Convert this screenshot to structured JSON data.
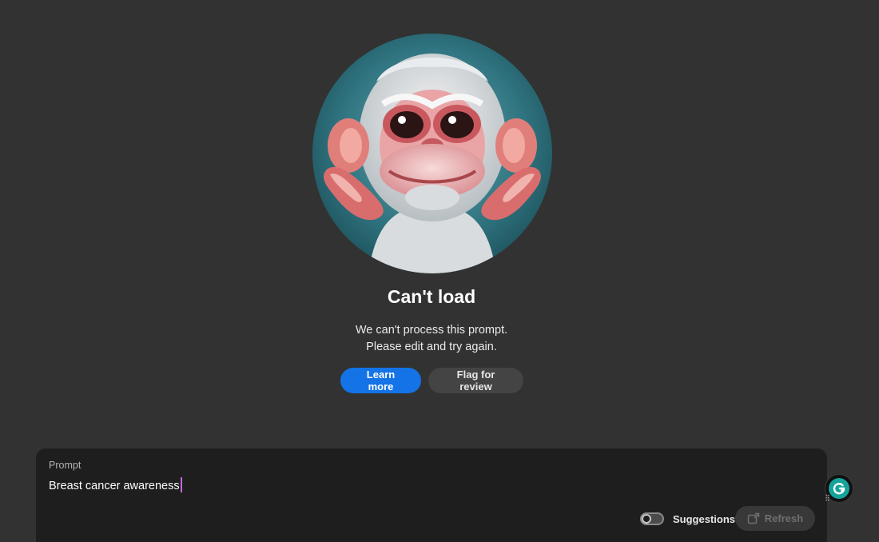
{
  "status": {
    "title": "Can't load",
    "message_line1": "We can't process this prompt.",
    "message_line2": "Please edit and try again.",
    "learn_more_label": "Learn more",
    "flag_label": "Flag for review"
  },
  "prompt": {
    "label": "Prompt",
    "value": "Breast cancer awareness",
    "suggestions_label": "Suggestions",
    "suggestions_enabled": false,
    "refresh_label": "Refresh",
    "refresh_enabled": false
  },
  "icons": {
    "illustration": "monkey-illustration",
    "refresh": "refresh-icon",
    "grammarly": "grammarly-icon"
  },
  "colors": {
    "background": "#323232",
    "panel": "#1e1e1e",
    "primary_button": "#1473e6",
    "secondary_button": "#444444",
    "caret": "#c66bd8",
    "grammarly": "#15a39a"
  }
}
